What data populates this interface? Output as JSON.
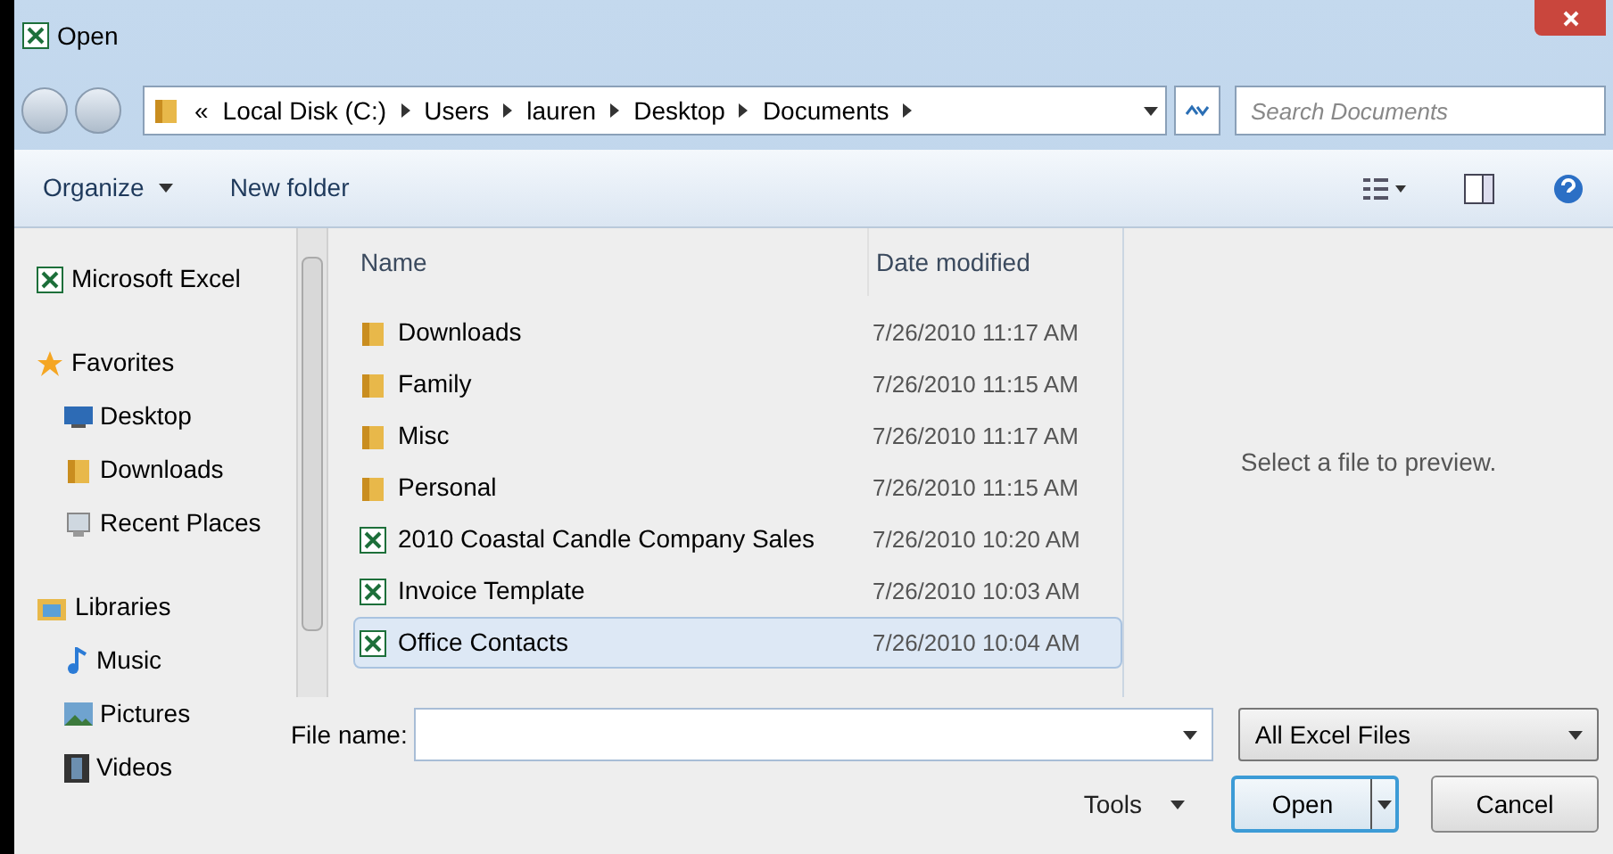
{
  "window": {
    "title": "Open"
  },
  "address": {
    "crumbs": [
      "«",
      "Local Disk (C:)",
      "Users",
      "lauren",
      "Desktop",
      "Documents"
    ]
  },
  "search": {
    "placeholder": "Search Documents"
  },
  "toolbar": {
    "buttons": [
      {
        "label": "Organize",
        "kind": "menu"
      },
      {
        "label": "New folder",
        "kind": "plain"
      }
    ]
  },
  "sidebar": {
    "items": [
      {
        "label": "Microsoft Excel",
        "kind": "excel"
      },
      {
        "label": "Favorites",
        "kind": "star",
        "children": [
          {
            "label": "Desktop",
            "kind": "desktop"
          },
          {
            "label": "Downloads",
            "kind": "downloads"
          },
          {
            "label": "Recent Places",
            "kind": "recent"
          }
        ]
      },
      {
        "label": "Libraries",
        "kind": "library",
        "children": [
          {
            "label": "Music",
            "kind": "music"
          },
          {
            "label": "Pictures",
            "kind": "pictures"
          },
          {
            "label": "Videos",
            "kind": "videos"
          }
        ]
      }
    ]
  },
  "table": {
    "columns": [
      "Name",
      "Date modified"
    ],
    "rows": [
      {
        "name": "Downloads",
        "date": "7/26/2010 11:17 AM",
        "kind": "folder",
        "selected": false
      },
      {
        "name": "Family",
        "date": "7/26/2010 11:15 AM",
        "kind": "folder",
        "selected": false
      },
      {
        "name": "Misc",
        "date": "7/26/2010 11:17 AM",
        "kind": "folder",
        "selected": false
      },
      {
        "name": "Personal",
        "date": "7/26/2010 11:15 AM",
        "kind": "folder",
        "selected": false
      },
      {
        "name": "2010 Coastal Candle Company Sales",
        "date": "7/26/2010 10:20 AM",
        "kind": "excel",
        "selected": false
      },
      {
        "name": "Invoice Template",
        "date": "7/26/2010 10:03 AM",
        "kind": "excel",
        "selected": false
      },
      {
        "name": "Office Contacts",
        "date": "7/26/2010 10:04 AM",
        "kind": "excel",
        "selected": true
      }
    ]
  },
  "preview": {
    "text": "Select a file to preview."
  },
  "file_name": {
    "label": "File name:"
  },
  "filter": {
    "value": "All Excel Files"
  },
  "buttons": [
    {
      "label": "Tools",
      "kind": "menu"
    },
    {
      "label": "Open",
      "kind": "split"
    },
    {
      "label": "Cancel",
      "kind": "plain"
    }
  ]
}
